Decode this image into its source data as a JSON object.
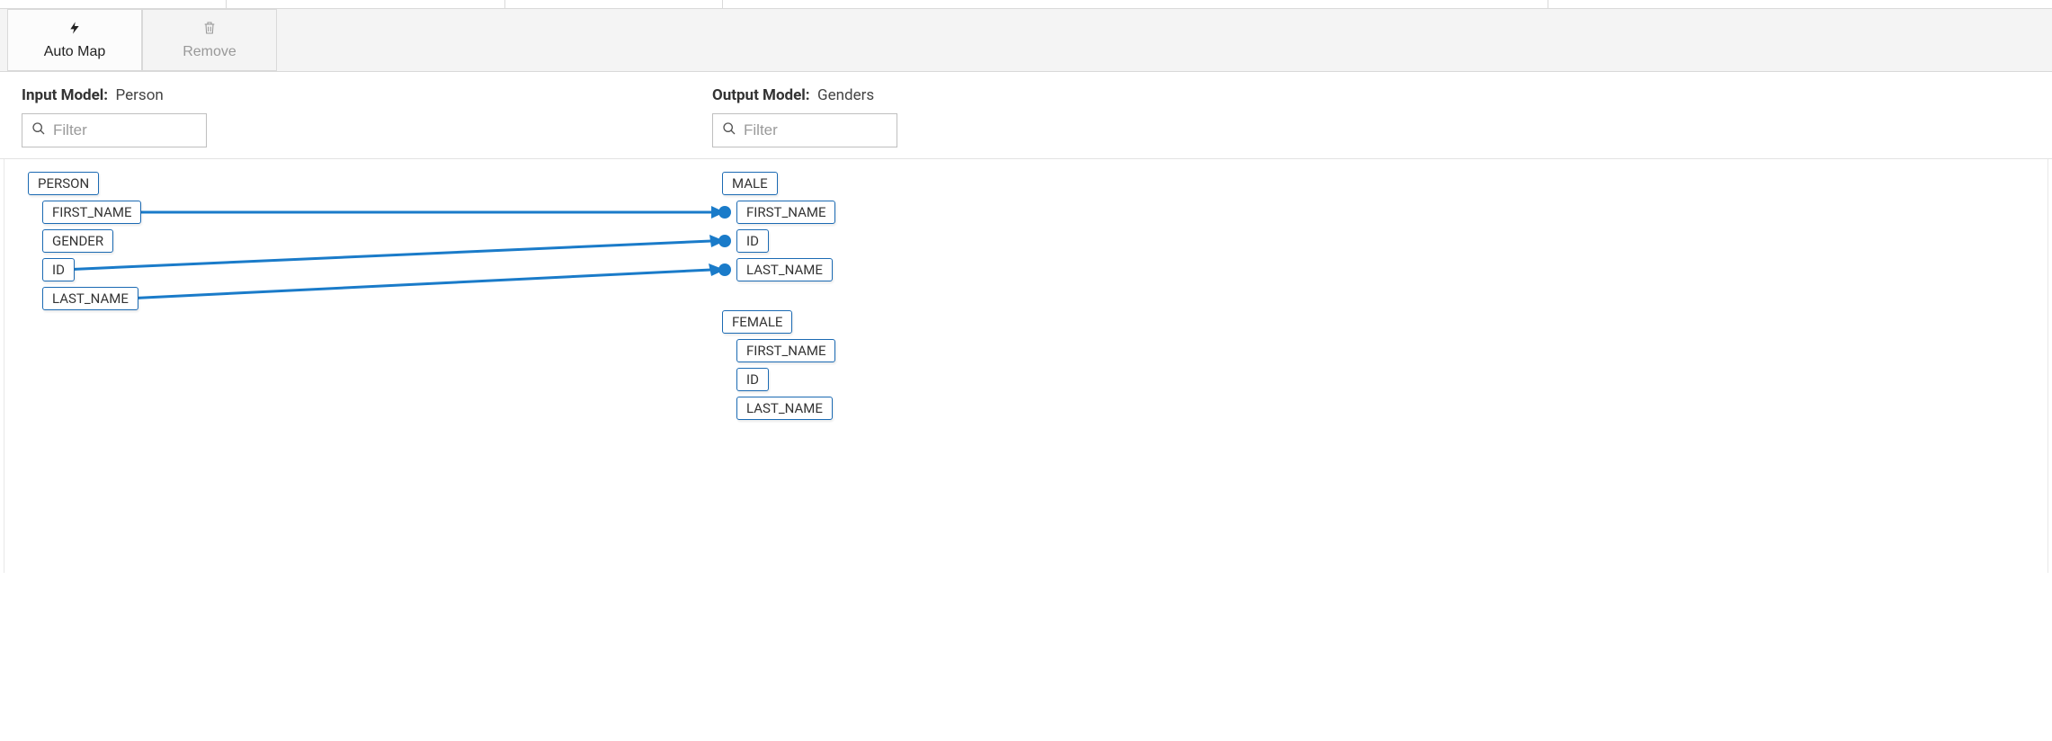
{
  "toolbar": {
    "autoMap": "Auto Map",
    "remove": "Remove"
  },
  "inputModel": {
    "label": "Input Model:",
    "name": "Person",
    "filterPlaceholder": "Filter",
    "root": "PERSON",
    "fields": [
      "FIRST_NAME",
      "GENDER",
      "ID",
      "LAST_NAME"
    ]
  },
  "outputModel": {
    "label": "Output Model:",
    "name": "Genders",
    "filterPlaceholder": "Filter",
    "groups": [
      {
        "name": "MALE",
        "fields": [
          "FIRST_NAME",
          "ID",
          "LAST_NAME"
        ]
      },
      {
        "name": "FEMALE",
        "fields": [
          "FIRST_NAME",
          "ID",
          "LAST_NAME"
        ]
      }
    ]
  },
  "mappings": [
    {
      "from": "FIRST_NAME",
      "to": "MALE.FIRST_NAME"
    },
    {
      "from": "ID",
      "to": "MALE.ID"
    },
    {
      "from": "LAST_NAME",
      "to": "MALE.LAST_NAME"
    }
  ],
  "colors": {
    "accent": "#1a7bc9"
  }
}
